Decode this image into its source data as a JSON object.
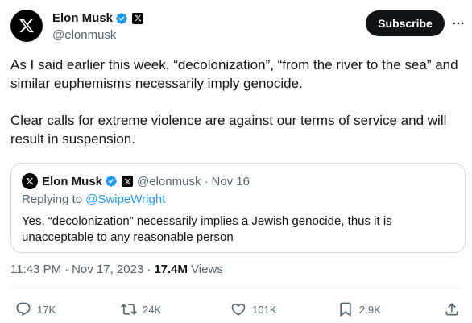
{
  "author": {
    "display_name": "Elon Musk",
    "handle": "@elonmusk"
  },
  "header": {
    "subscribe_label": "Subscribe",
    "more_label": "···"
  },
  "tweet": {
    "paragraphs": [
      "As I said earlier this week, “decolonization”, “from the river to the sea” and similar euphemisms necessarily imply genocide.",
      "Clear calls for extreme violence are against our terms of service and will result in suspension."
    ]
  },
  "quote": {
    "display_name": "Elon Musk",
    "handle": "@elonmusk",
    "separator": "·",
    "date": "Nov 16",
    "replying_prefix": "Replying to ",
    "replying_to": "@SwipeWright",
    "text": "Yes, “decolonization” necessarily implies a Jewish genocide, thus it is unacceptable to any reasonable person"
  },
  "meta": {
    "time": "11:43 PM",
    "separator": "·",
    "date": "Nov 17, 2023",
    "views_count": "17.4M",
    "views_label": "Views"
  },
  "actions": {
    "replies": "17K",
    "reposts": "24K",
    "likes": "101K",
    "bookmarks": "2.9K"
  },
  "colors": {
    "text_primary": "#0f1419",
    "text_secondary": "#536471",
    "verified": "#1d9bf0",
    "link": "#1d9bf0",
    "border": "#cfd9de"
  },
  "icons": {
    "avatar": "x-logo-icon",
    "verified": "verified-badge-icon",
    "affiliate": "x-affiliate-icon",
    "reply": "reply-icon",
    "repost": "repost-icon",
    "like": "heart-icon",
    "bookmark": "bookmark-icon",
    "share": "share-icon"
  }
}
